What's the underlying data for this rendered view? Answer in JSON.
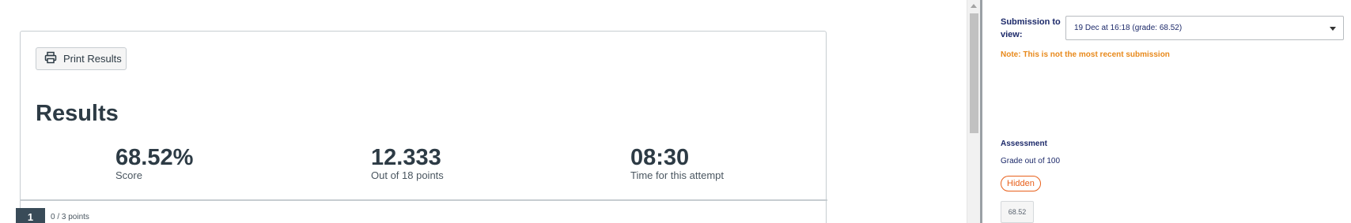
{
  "results": {
    "print_label": "Print Results",
    "title": "Results",
    "stats": [
      {
        "value": "68.52%",
        "label": "Score"
      },
      {
        "value": "12.333",
        "label": "Out of 18 points"
      },
      {
        "value": "08:30",
        "label": "Time for this attempt"
      }
    ]
  },
  "question": {
    "number": "1",
    "points": "0 / 3 points"
  },
  "sidebar": {
    "submission_label": "Submission to view:",
    "submission_selected": "19 Dec at 16:18 (grade: 68.52)",
    "note": "Note: This is not the most recent submission",
    "assessment_title": "Assessment",
    "grade_out_of": "Grade out of 100",
    "hidden_label": "Hidden",
    "grade_value": "68.52"
  },
  "icons": {
    "print": "printer-icon",
    "dropdown": "chevron-down-icon",
    "scroll_up": "arrow-up-icon"
  },
  "colors": {
    "note_orange": "#e8891b",
    "hidden_orange": "#e8601b",
    "navy_text": "#1d2a6a",
    "dark_text": "#2d3b45",
    "badge_bg": "#394b58"
  }
}
